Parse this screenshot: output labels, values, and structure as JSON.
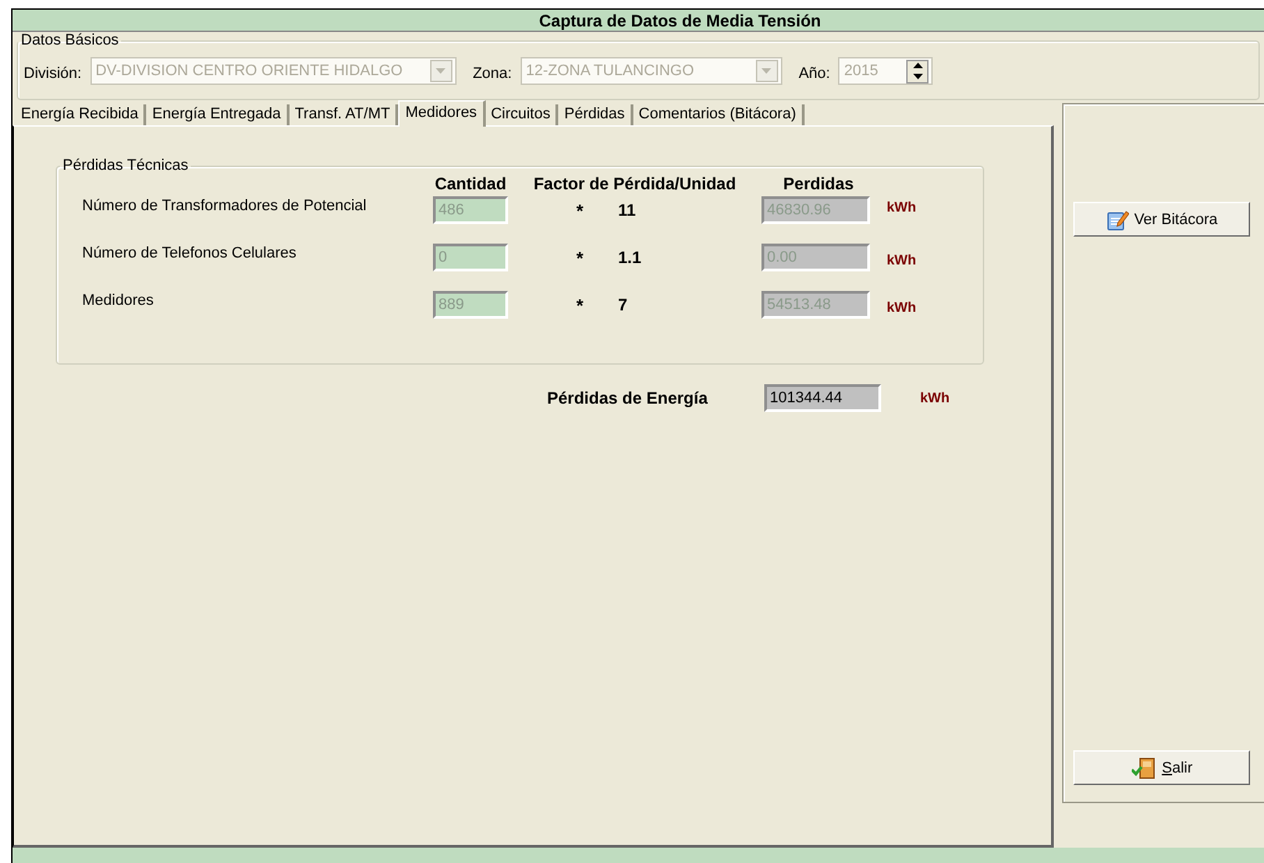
{
  "window": {
    "title": "Captura de Datos de Media Tensión"
  },
  "datos_basicos": {
    "legend": "Datos Básicos",
    "fields": [
      {
        "kind": "combo",
        "label": "División:",
        "value": "DV-DIVISION CENTRO ORIENTE HIDALGO",
        "disabled": true
      },
      {
        "kind": "combo",
        "label": "Zona:",
        "value": "12-ZONA TULANCINGO",
        "disabled": true
      },
      {
        "kind": "spinner",
        "label": "Año:",
        "value": "2015",
        "disabled": true
      }
    ]
  },
  "tabs": [
    {
      "label": "Energía Recibida",
      "selected": false
    },
    {
      "label": "Energía Entregada",
      "selected": false
    },
    {
      "label": "Transf. AT/MT",
      "selected": false
    },
    {
      "label": "Medidores",
      "selected": true
    },
    {
      "label": "Circuitos",
      "selected": false
    },
    {
      "label": "Pérdidas",
      "selected": false
    },
    {
      "label": "Comentarios (Bitácora)",
      "selected": false
    }
  ],
  "perdidas_tecnicas": {
    "legend": "Pérdidas Técnicas",
    "columns": [
      "Cantidad",
      "Factor de Pérdida/Unidad",
      "Perdidas"
    ],
    "rows": [
      {
        "label": "Número de  Transformadores de Potencial",
        "cantidad": "486",
        "operator": "*",
        "factor": "11",
        "perdidas": "46830.96",
        "unit": "kWh",
        "disabled": true
      },
      {
        "label": "Número de Telefonos Celulares",
        "cantidad": "0",
        "operator": "*",
        "factor": "1.1",
        "perdidas": "0.00",
        "unit": "kWh",
        "disabled": true
      },
      {
        "label": "Medidores",
        "cantidad": "889",
        "operator": "*",
        "factor": "7",
        "perdidas": "54513.48",
        "unit": "kWh",
        "disabled": true
      }
    ]
  },
  "total": {
    "label": "Pérdidas de Energía",
    "value": "101344.44",
    "unit": "kWh",
    "disabled": false
  },
  "buttons": [
    {
      "kind": "log",
      "label": "Ver Bitácora"
    },
    {
      "kind": "exit",
      "label": "Salir"
    }
  ]
}
